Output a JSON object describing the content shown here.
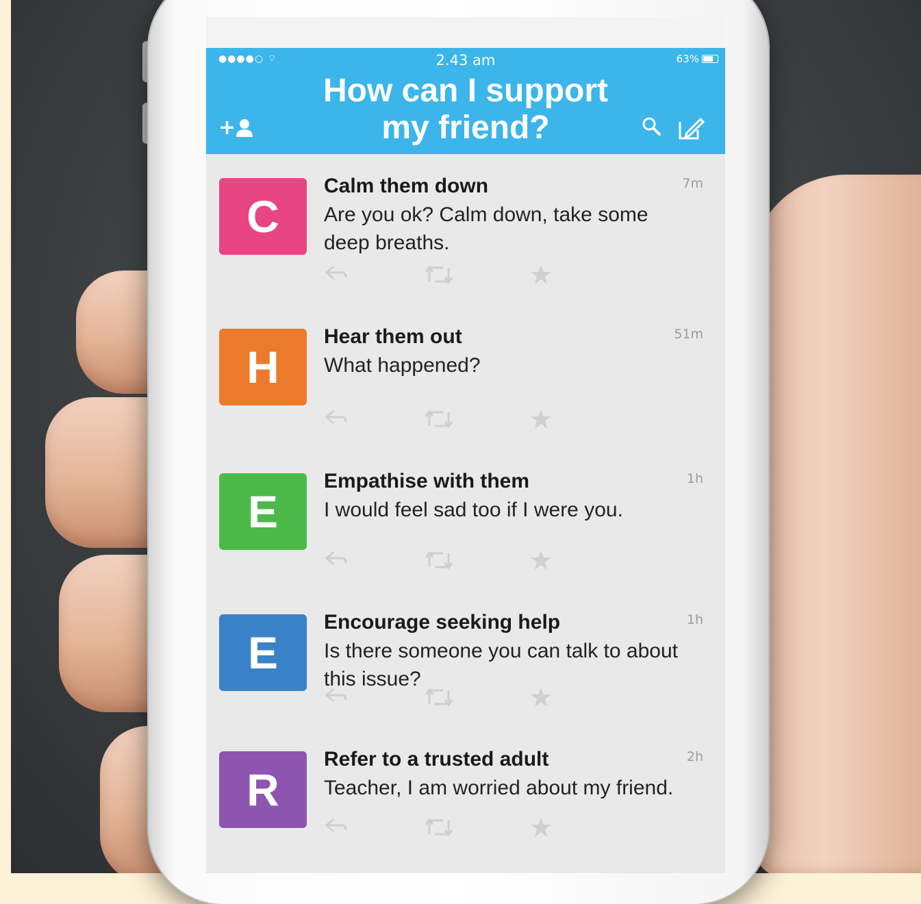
{
  "status_bar": {
    "signal": "●●●●○ ⌔",
    "time": "2.43 am",
    "battery": "63%"
  },
  "header": {
    "title_line1": "How can I support",
    "title_line2": "my friend?"
  },
  "icons": {
    "add_user": "+👤",
    "search": "🔍",
    "compose": "✍",
    "reply": "↶",
    "retweet": "⇅",
    "favorite": "★"
  },
  "messages": [
    {
      "letter": "C",
      "color": "#e84584",
      "title": "Calm them down",
      "body": "Are you ok? Calm down, take some deep breaths.",
      "time": "7m"
    },
    {
      "letter": "H",
      "color": "#ec7a2c",
      "title": "Hear them out",
      "body": "What happened?",
      "time": "51m"
    },
    {
      "letter": "E",
      "color": "#4cba49",
      "title": "Empathise with them",
      "body": "I would feel sad too if I were you.",
      "time": "1h"
    },
    {
      "letter": "E",
      "color": "#3a82c8",
      "title": "Encourage seeking help",
      "body": "Is there someone you can talk to about this issue?",
      "time": "1h"
    },
    {
      "letter": "R",
      "color": "#8d55b0",
      "title": "Refer to a trusted adult",
      "body": "Teacher, I am worried about my friend.",
      "time": "2h"
    }
  ]
}
